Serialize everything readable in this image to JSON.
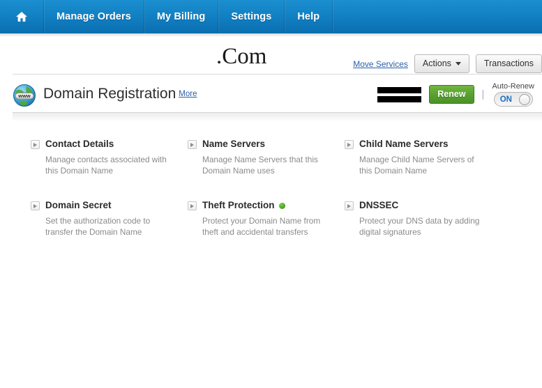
{
  "topnav": {
    "home_icon": "home-icon",
    "items": [
      {
        "label": "Manage Orders"
      },
      {
        "label": "My Billing"
      },
      {
        "label": "Settings"
      },
      {
        "label": "Help"
      }
    ]
  },
  "header": {
    "title": ".Com",
    "move_services_label": "Move Services",
    "actions_label": "Actions",
    "transactions_label": "Transactions"
  },
  "product": {
    "icon": "globe-www-icon",
    "name": "Domain Registration",
    "more_label": "More",
    "renew_label": "Renew",
    "separator": "|",
    "autorenew_label": "Auto-Renew",
    "autorenew_state": "ON"
  },
  "services": [
    {
      "title": "Contact Details",
      "desc": "Manage contacts associated with this Domain Name",
      "status": null
    },
    {
      "title": "Name Servers",
      "desc": "Manage Name Servers that this Domain Name uses",
      "status": null
    },
    {
      "title": "Child Name Servers",
      "desc": "Manage Child Name Servers of this Domain Name",
      "status": null
    },
    {
      "title": "Domain Secret",
      "desc": "Set the authorization code to transfer the Domain Name",
      "status": null
    },
    {
      "title": "Theft Protection",
      "desc": "Protect your Domain Name from theft and accidental transfers",
      "status": "active"
    },
    {
      "title": "DNSSEC",
      "desc": "Protect your DNS data by adding digital signatures",
      "status": null
    }
  ],
  "colors": {
    "nav_blue": "#1281c4",
    "link_blue": "#2b5fa8",
    "renew_green": "#57a02e",
    "status_green": "#3f9c1d"
  }
}
